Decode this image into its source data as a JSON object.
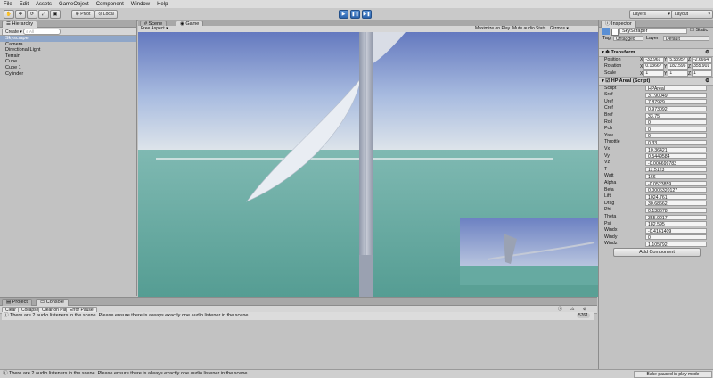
{
  "menu": [
    "File",
    "Edit",
    "Assets",
    "GameObject",
    "Component",
    "Window",
    "Help"
  ],
  "toolbar": {
    "pivot": "Pivot",
    "local": "Local",
    "layers": "Layers",
    "layout": "Layout"
  },
  "hierarchy": {
    "tab": "Hierarchy",
    "create": "Create",
    "search_placeholder": "All",
    "items": [
      "Skyscraper",
      "Camera",
      "Directional Light",
      "Terrain",
      "Cube",
      "Cube 1",
      "Cylinder"
    ]
  },
  "view": {
    "tabs": [
      "Scene",
      "Game"
    ],
    "aspect": "Free Aspect",
    "buttons": [
      "Maximize on Play",
      "Mute audio",
      "Stats",
      "Gizmos"
    ]
  },
  "inspector": {
    "tab": "Inspector",
    "object_name": "SkyScraper",
    "static_label": "Static",
    "tag_label": "Tag",
    "tag_value": "Untagged",
    "layer_label": "Layer",
    "layer_value": "Default",
    "transform_title": "Transform",
    "transform": [
      {
        "label": "Position",
        "x": "-33.961",
        "y": "5.53957",
        "z": "-2.6664"
      },
      {
        "label": "Rotation",
        "x": "0.13667",
        "y": "182.595",
        "z": "355.901"
      },
      {
        "label": "Scale",
        "x": "1",
        "y": "1",
        "z": "1"
      }
    ],
    "script_title": "HP Areal (Script)",
    "fields": [
      {
        "label": "Script",
        "value": "HPAreal"
      },
      {
        "label": "Sref",
        "value": "31.90049"
      },
      {
        "label": "Uref",
        "value": "7.87929"
      },
      {
        "label": "Cref",
        "value": "0.973092"
      },
      {
        "label": "Bref",
        "value": "33.75"
      },
      {
        "label": "Roll",
        "value": "0"
      },
      {
        "label": "Pch",
        "value": "0"
      },
      {
        "label": "Yaw",
        "value": "0"
      },
      {
        "label": "Throttle",
        "value": "0.33"
      },
      {
        "label": "Vx",
        "value": "10.36421"
      },
      {
        "label": "Vy",
        "value": "0.5449584"
      },
      {
        "label": "Vz",
        "value": "-0.006699783"
      },
      {
        "label": "T",
        "value": "11.5123"
      },
      {
        "label": "Watt",
        "value": "166"
      },
      {
        "label": "Alpha",
        "value": "-0.0523859"
      },
      {
        "label": "Beta",
        "value": "0.0006320127"
      },
      {
        "label": "Lift",
        "value": "1024.761"
      },
      {
        "label": "Drag",
        "value": "30.68662"
      },
      {
        "label": "Phi",
        "value": "0.138678"
      },
      {
        "label": "Theta",
        "value": "355.9017"
      },
      {
        "label": "Psi",
        "value": "182.595"
      },
      {
        "label": "Windx",
        "value": "-0.4161409"
      },
      {
        "label": "Windy",
        "value": "0"
      },
      {
        "label": "Windz",
        "value": "1.105792"
      }
    ],
    "add_component": "Add Component"
  },
  "bottom": {
    "tabs": [
      "Project",
      "Console"
    ],
    "buttons": [
      "Clear",
      "Collapse",
      "Clear on Play",
      "Error Pause"
    ],
    "message": "There are 2 audio listeners in the scene. Please ensure there is always exactly one audio listener in the scene.",
    "count": "5761"
  },
  "status": {
    "message": "There are 2 audio listeners in the scene. Please ensure there is always exactly one audio listener in the scene.",
    "bake": "Bake paused in play mode"
  },
  "colors": {
    "sky_top": "#6f86c6",
    "sky_bottom": "#d3dce8",
    "sea": "#5fa79e",
    "play_blue": "#3b74c0"
  }
}
